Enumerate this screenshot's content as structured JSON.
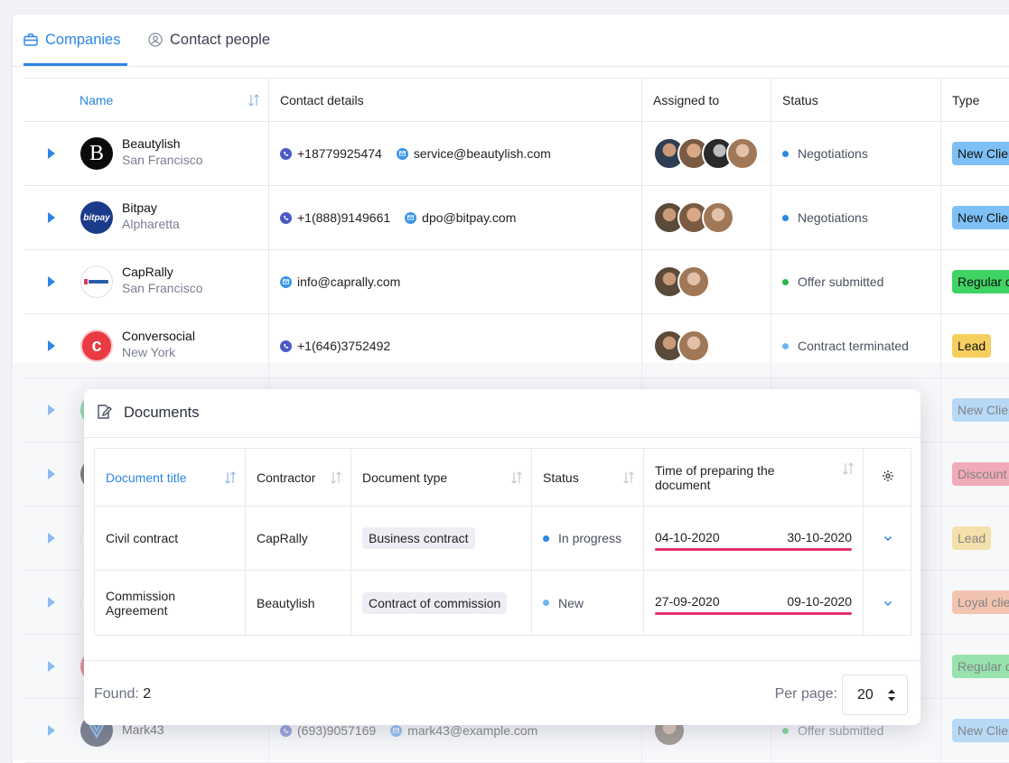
{
  "tabs": [
    {
      "label": "Companies",
      "icon": "briefcase-icon",
      "active": true
    },
    {
      "label": "Contact people",
      "icon": "user-circle-icon",
      "active": false
    }
  ],
  "companies_table": {
    "headers": {
      "name": "Name",
      "contact": "Contact details",
      "assigned": "Assigned to",
      "status": "Status",
      "type": "Type"
    },
    "rows": [
      {
        "name": "Beautylish",
        "city": "San Francisco",
        "phone": "+18779925474",
        "email": "service@beautylish.com",
        "status": "Negotiations",
        "type": "New Client"
      },
      {
        "name": "Bitpay",
        "city": "Alpharetta",
        "phone": "+1(888)9149661",
        "email": "dpo@bitpay.com",
        "status": "Negotiations",
        "type": "New Client"
      },
      {
        "name": "CapRally",
        "city": "San Francisco",
        "phone": "",
        "email": "info@caprally.com",
        "status": "Offer submitted",
        "type": "Regular client"
      },
      {
        "name": "Conversocial",
        "city": "New York",
        "phone": "+1(646)3752492",
        "email": "",
        "status": "Contract terminated",
        "type": "Lead"
      },
      {
        "type": "New Client"
      },
      {
        "type": "Discount"
      },
      {
        "type": "Lead"
      },
      {
        "type": "Loyal client"
      },
      {
        "type": "Regular client"
      },
      {
        "name": "Mark43",
        "phone": "(693)9057169",
        "email": "mark43@example.com",
        "status": "Offer submitted",
        "type": "New Client"
      }
    ]
  },
  "documents": {
    "title": "Documents",
    "headers": {
      "title": "Document title",
      "contractor": "Contractor",
      "type": "Document type",
      "status": "Status",
      "time": "Time of preparing the document"
    },
    "rows": [
      {
        "title": "Civil contract",
        "contractor": "CapRally",
        "type": "Business contract",
        "status": "In progress",
        "start": "04-10-2020",
        "end": "30-10-2020"
      },
      {
        "title": "Commission Agreement",
        "contractor": "Beautylish",
        "type": "Contract of commission",
        "status": "New",
        "start": "27-09-2020",
        "end": "09-10-2020"
      }
    ],
    "found_label": "Found:",
    "found_count": "2",
    "per_page_label": "Per page:",
    "per_page_value": "20"
  },
  "colors": {
    "accent": "#2b86e4",
    "negotiations": "#2b86e4",
    "offer_submitted": "#2bb84a",
    "contract_terminated": "#6ab8ef",
    "new_client": "#7ec0f5",
    "regular_client": "#3fd364",
    "lead": "#f6ce5f",
    "discount": "#f2647a",
    "loyal_client": "#f5976b",
    "date_bar": "#e4336b"
  }
}
